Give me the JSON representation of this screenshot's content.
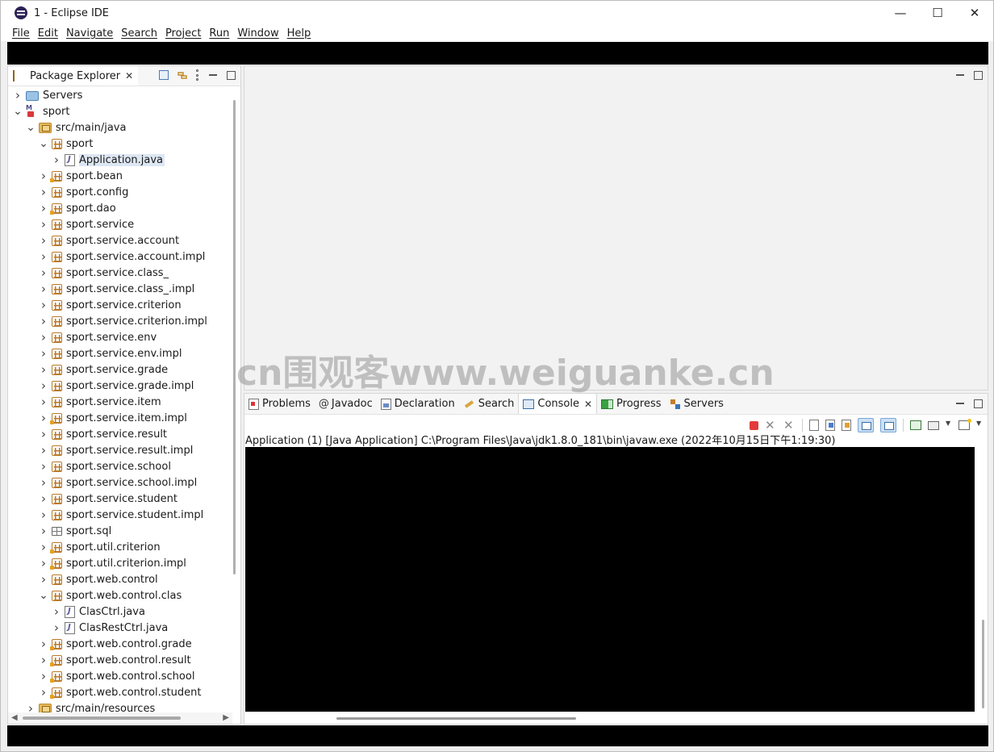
{
  "window": {
    "title": "1 - Eclipse IDE"
  },
  "menu": [
    "File",
    "Edit",
    "Navigate",
    "Search",
    "Project",
    "Run",
    "Window",
    "Help"
  ],
  "package_explorer": {
    "tab_label": "Package Explorer",
    "tree": [
      {
        "label": "Servers",
        "depth": 0,
        "expand": "collapsed",
        "icon": "folder-icon"
      },
      {
        "label": "sport",
        "depth": 0,
        "expand": "expanded",
        "icon": "project-icon"
      },
      {
        "label": "src/main/java",
        "depth": 1,
        "expand": "expanded",
        "icon": "source-folder-icon"
      },
      {
        "label": "sport",
        "depth": 2,
        "expand": "expanded",
        "icon": "package-icon"
      },
      {
        "label": "Application.java",
        "depth": 3,
        "expand": "collapsed",
        "icon": "java-file-icon",
        "selected": true
      },
      {
        "label": "sport.bean",
        "depth": 2,
        "expand": "collapsed",
        "icon": "package-modified-icon"
      },
      {
        "label": "sport.config",
        "depth": 2,
        "expand": "collapsed",
        "icon": "package-icon"
      },
      {
        "label": "sport.dao",
        "depth": 2,
        "expand": "collapsed",
        "icon": "package-modified-icon"
      },
      {
        "label": "sport.service",
        "depth": 2,
        "expand": "collapsed",
        "icon": "package-icon"
      },
      {
        "label": "sport.service.account",
        "depth": 2,
        "expand": "collapsed",
        "icon": "package-icon"
      },
      {
        "label": "sport.service.account.impl",
        "depth": 2,
        "expand": "collapsed",
        "icon": "package-icon"
      },
      {
        "label": "sport.service.class_",
        "depth": 2,
        "expand": "collapsed",
        "icon": "package-icon"
      },
      {
        "label": "sport.service.class_.impl",
        "depth": 2,
        "expand": "collapsed",
        "icon": "package-icon"
      },
      {
        "label": "sport.service.criterion",
        "depth": 2,
        "expand": "collapsed",
        "icon": "package-icon"
      },
      {
        "label": "sport.service.criterion.impl",
        "depth": 2,
        "expand": "collapsed",
        "icon": "package-icon"
      },
      {
        "label": "sport.service.env",
        "depth": 2,
        "expand": "collapsed",
        "icon": "package-icon"
      },
      {
        "label": "sport.service.env.impl",
        "depth": 2,
        "expand": "collapsed",
        "icon": "package-icon"
      },
      {
        "label": "sport.service.grade",
        "depth": 2,
        "expand": "collapsed",
        "icon": "package-icon"
      },
      {
        "label": "sport.service.grade.impl",
        "depth": 2,
        "expand": "collapsed",
        "icon": "package-icon"
      },
      {
        "label": "sport.service.item",
        "depth": 2,
        "expand": "collapsed",
        "icon": "package-icon"
      },
      {
        "label": "sport.service.item.impl",
        "depth": 2,
        "expand": "collapsed",
        "icon": "package-modified-icon"
      },
      {
        "label": "sport.service.result",
        "depth": 2,
        "expand": "collapsed",
        "icon": "package-icon"
      },
      {
        "label": "sport.service.result.impl",
        "depth": 2,
        "expand": "collapsed",
        "icon": "package-icon"
      },
      {
        "label": "sport.service.school",
        "depth": 2,
        "expand": "collapsed",
        "icon": "package-icon"
      },
      {
        "label": "sport.service.school.impl",
        "depth": 2,
        "expand": "collapsed",
        "icon": "package-icon"
      },
      {
        "label": "sport.service.student",
        "depth": 2,
        "expand": "collapsed",
        "icon": "package-icon"
      },
      {
        "label": "sport.service.student.impl",
        "depth": 2,
        "expand": "collapsed",
        "icon": "package-icon"
      },
      {
        "label": "sport.sql",
        "depth": 2,
        "expand": "collapsed",
        "icon": "sql-package-icon"
      },
      {
        "label": "sport.util.criterion",
        "depth": 2,
        "expand": "collapsed",
        "icon": "package-modified-icon"
      },
      {
        "label": "sport.util.criterion.impl",
        "depth": 2,
        "expand": "collapsed",
        "icon": "package-modified-icon"
      },
      {
        "label": "sport.web.control",
        "depth": 2,
        "expand": "collapsed",
        "icon": "package-icon"
      },
      {
        "label": "sport.web.control.clas",
        "depth": 2,
        "expand": "expanded",
        "icon": "package-icon"
      },
      {
        "label": "ClasCtrl.java",
        "depth": 3,
        "expand": "collapsed",
        "icon": "java-file-icon"
      },
      {
        "label": "ClasRestCtrl.java",
        "depth": 3,
        "expand": "collapsed",
        "icon": "java-file-icon"
      },
      {
        "label": "sport.web.control.grade",
        "depth": 2,
        "expand": "collapsed",
        "icon": "package-modified-icon"
      },
      {
        "label": "sport.web.control.result",
        "depth": 2,
        "expand": "collapsed",
        "icon": "package-modified-icon"
      },
      {
        "label": "sport.web.control.school",
        "depth": 2,
        "expand": "collapsed",
        "icon": "package-modified-icon"
      },
      {
        "label": "sport.web.control.student",
        "depth": 2,
        "expand": "collapsed",
        "icon": "package-modified-icon"
      },
      {
        "label": "src/main/resources",
        "depth": 1,
        "expand": "collapsed",
        "icon": "source-folder-icon"
      }
    ]
  },
  "bottom_tabs": [
    {
      "label": "Problems",
      "icon": "problems-icon"
    },
    {
      "label": "Javadoc",
      "icon": "javadoc-icon"
    },
    {
      "label": "Declaration",
      "icon": "declaration-icon"
    },
    {
      "label": "Search",
      "icon": "search-icon"
    },
    {
      "label": "Console",
      "icon": "console-icon",
      "active": true
    },
    {
      "label": "Progress",
      "icon": "progress-icon"
    },
    {
      "label": "Servers",
      "icon": "servers-icon"
    }
  ],
  "console": {
    "launch_label": "Application (1) [Java Application] C:\\Program Files\\Java\\jdk1.8.0_181\\bin\\javaw.exe  (2022年10月15日下午1:19:30)"
  },
  "watermark": "cn围观客www.weiguanke.cn",
  "symbols": {
    "close": "✕",
    "minimize": "—",
    "maximize": "☐",
    "tab_close": "✕"
  }
}
